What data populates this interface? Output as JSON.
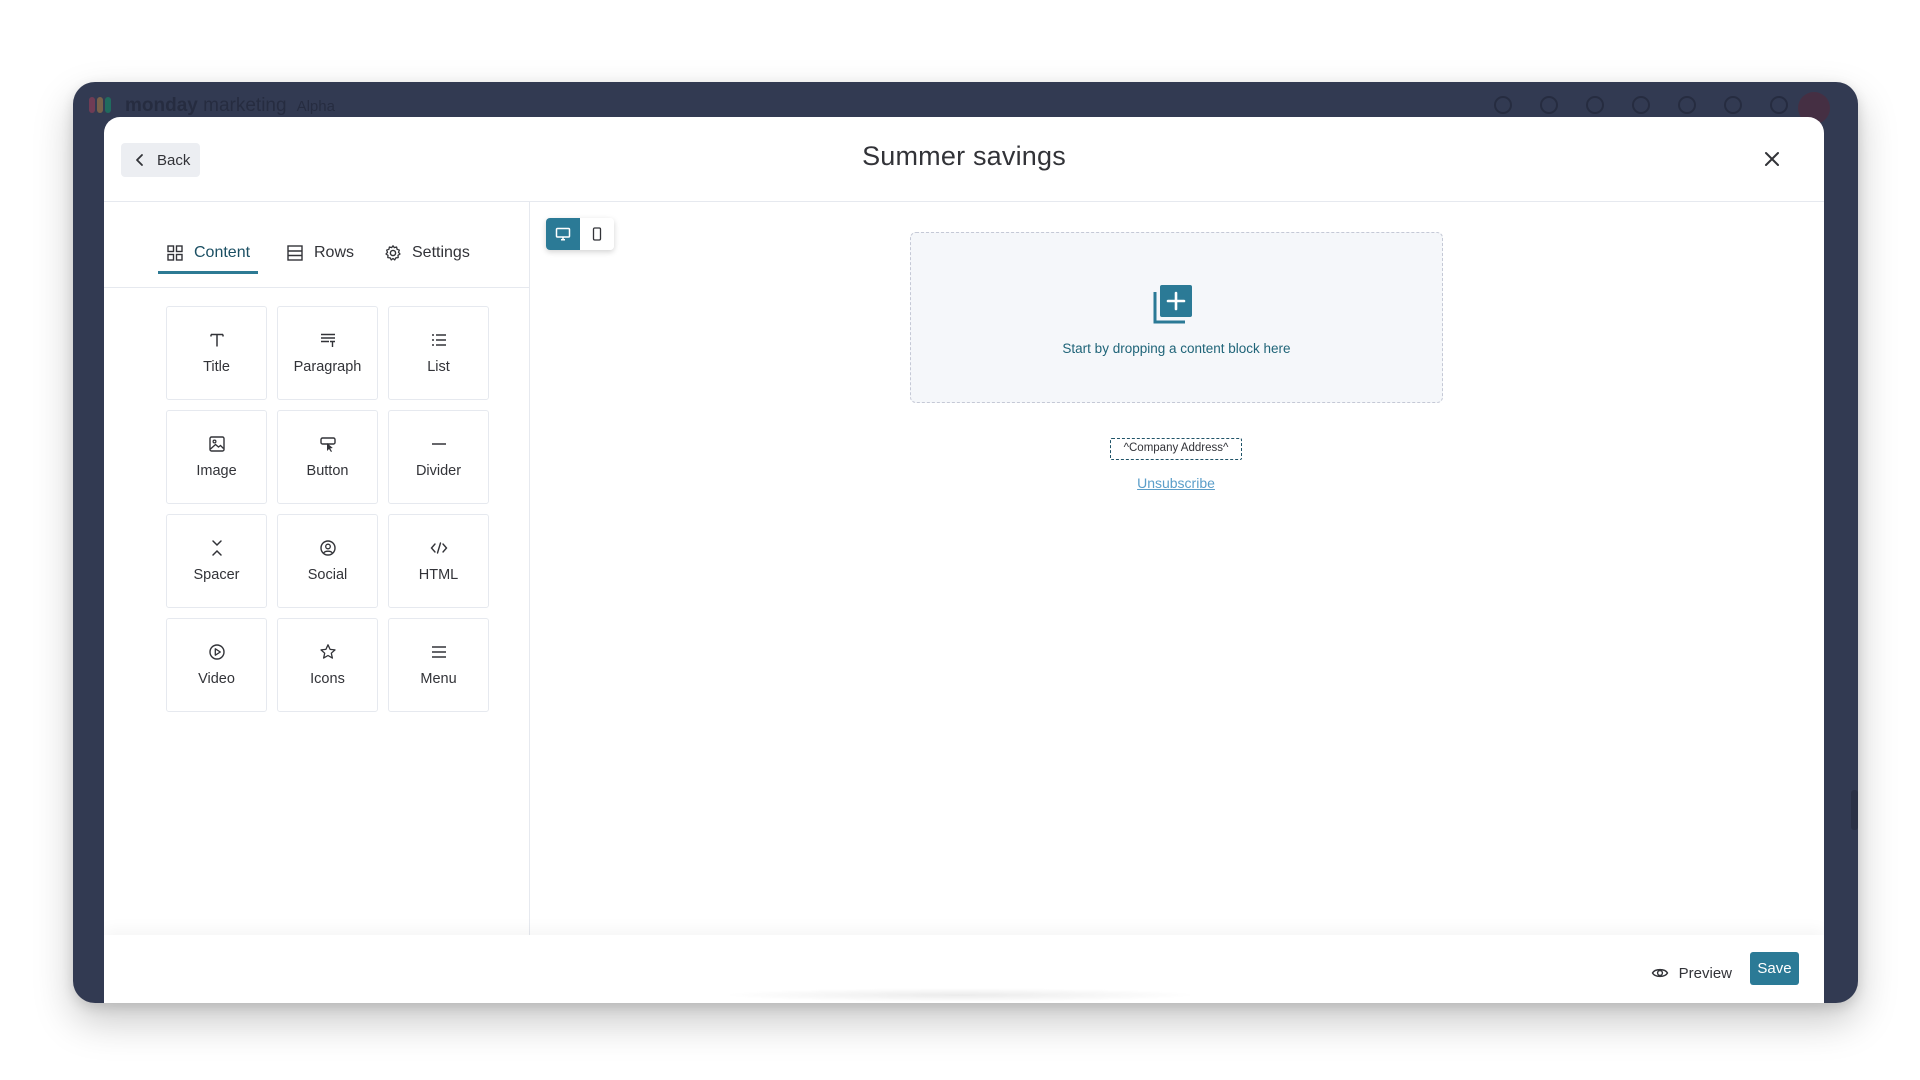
{
  "app": {
    "brand_bold": "monday",
    "brand_light": "marketing",
    "brand_tag": "Alpha"
  },
  "header": {
    "back_label": "Back",
    "title": "Summer savings"
  },
  "sidebar": {
    "tabs": [
      {
        "label": "Content",
        "icon": "grid-icon",
        "active": true
      },
      {
        "label": "Rows",
        "icon": "rows-icon",
        "active": false
      },
      {
        "label": "Settings",
        "icon": "gear-icon",
        "active": false
      }
    ],
    "blocks": [
      {
        "label": "Title",
        "icon": "title-icon"
      },
      {
        "label": "Paragraph",
        "icon": "paragraph-icon"
      },
      {
        "label": "List",
        "icon": "list-icon"
      },
      {
        "label": "Image",
        "icon": "image-icon"
      },
      {
        "label": "Button",
        "icon": "button-icon"
      },
      {
        "label": "Divider",
        "icon": "divider-icon"
      },
      {
        "label": "Spacer",
        "icon": "spacer-icon"
      },
      {
        "label": "Social",
        "icon": "social-icon"
      },
      {
        "label": "HTML",
        "icon": "html-icon"
      },
      {
        "label": "Video",
        "icon": "video-icon"
      },
      {
        "label": "Icons",
        "icon": "star-icon"
      },
      {
        "label": "Menu",
        "icon": "menu-icon"
      }
    ]
  },
  "canvas": {
    "dropzone_text": "Start by dropping a content block here",
    "company_address": "^Company Address^",
    "unsubscribe": "Unsubscribe",
    "view_mode": "desktop"
  },
  "footer": {
    "preview_label": "Preview",
    "save_label": "Save"
  },
  "colors": {
    "accent": "#2b7a96",
    "backdrop": "#323a52",
    "link": "#5b9ec9"
  }
}
